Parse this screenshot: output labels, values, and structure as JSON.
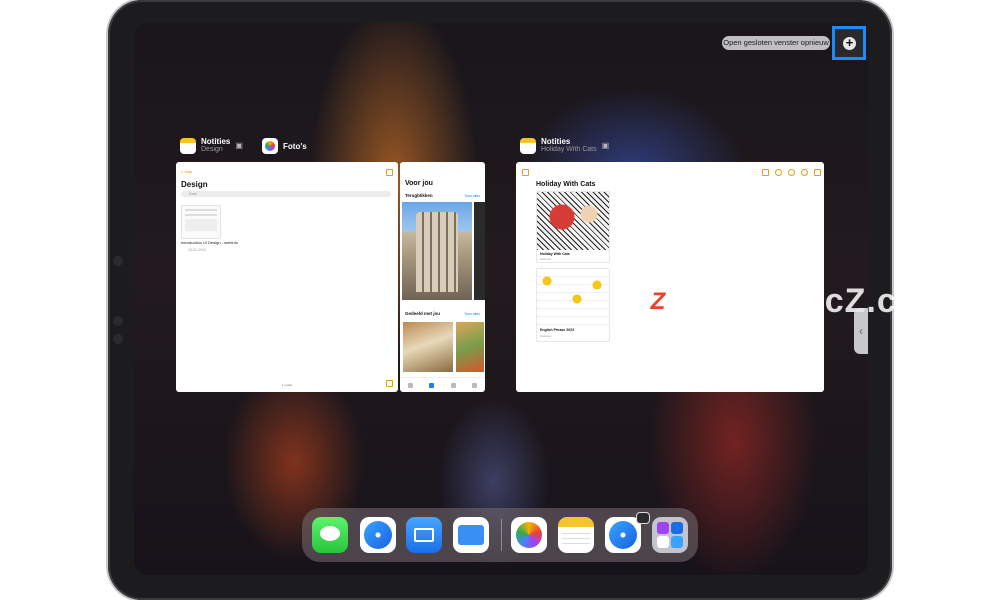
{
  "tooltip": {
    "reopen_closed_window": "Open gesloten venster opnieuw"
  },
  "left_group": {
    "notes_app": {
      "title": "Notities",
      "subtitle": "Design"
    },
    "photos_app": {
      "title": "Foto's"
    },
    "notes_window": {
      "back": "< Map",
      "heading": "Design",
      "search_placeholder": "Zoek",
      "note_title": "Introduction UI Design - webinfo",
      "note_date": "15-01-2024",
      "footer": "1 notitie"
    },
    "photos_window": {
      "heading": "Voor jou",
      "memories": "Terugblikken",
      "see_all_1": "Toon alles",
      "shared": "Gedeeld met jou",
      "see_all_2": "Toon alles"
    }
  },
  "right_group": {
    "notes_app": {
      "title": "Notities",
      "subtitle": "Holiday With Cats"
    },
    "window": {
      "heading": "Holiday With Cats",
      "card1_title": "Holiday With Cats",
      "card1_date": "Gisteren",
      "card2_title": "English Phrase 2023",
      "card2_date": "Gisteren"
    }
  },
  "watermark": {
    "logo": "Z",
    "text": "www.MacZ.com"
  },
  "dock": {
    "apps": [
      "messages-icon",
      "safari-icon",
      "mail-icon",
      "files-icon",
      "photos-icon",
      "notes-icon",
      "safari-icon",
      "app-library-icon"
    ]
  },
  "colors": {
    "accent": "#1a8cff",
    "notes_yellow": "#f7c52a",
    "link_blue": "#1a7cff"
  }
}
